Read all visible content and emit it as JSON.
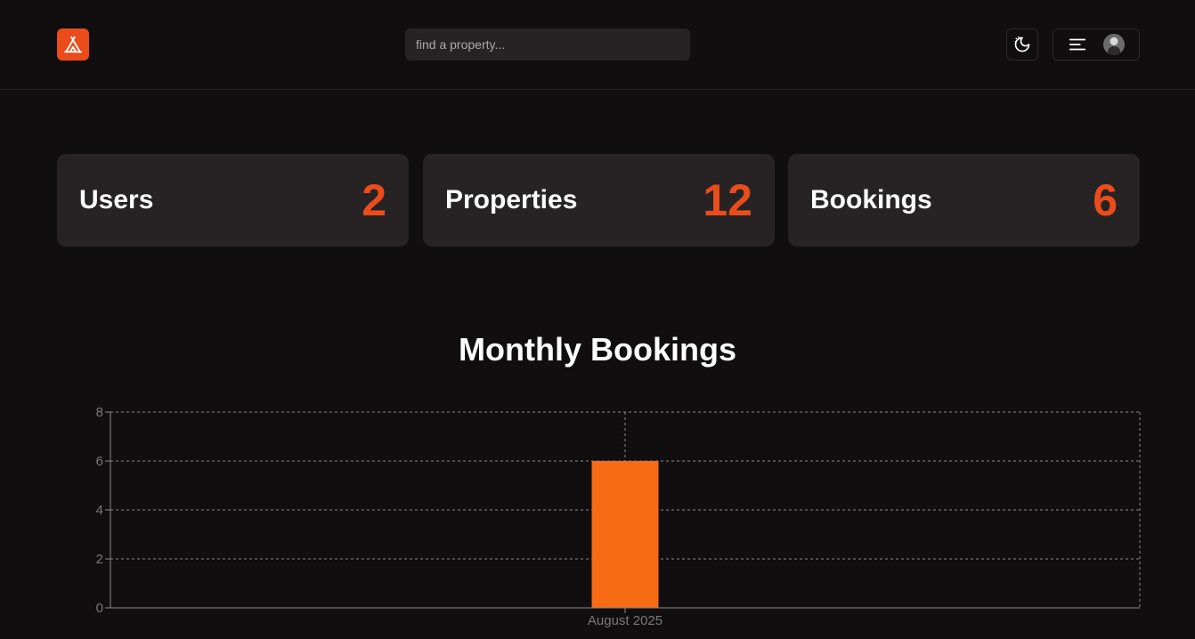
{
  "search": {
    "placeholder": "find a property..."
  },
  "icons": {
    "logo": "tent-icon",
    "theme": "moon-icon",
    "menu": "menu-icon",
    "user": "avatar"
  },
  "colors": {
    "accent": "#ea4c1c",
    "bar": "#f76b15",
    "background": "#100e0f",
    "card": "#272324"
  },
  "stats": [
    {
      "label": "Users",
      "value": "2"
    },
    {
      "label": "Properties",
      "value": "12"
    },
    {
      "label": "Bookings",
      "value": "6"
    }
  ],
  "chart_title": "Monthly Bookings",
  "chart_data": {
    "type": "bar",
    "categories": [
      "August 2025"
    ],
    "values": [
      6
    ],
    "title": "Monthly Bookings",
    "xlabel": "",
    "ylabel": "",
    "ylim": [
      0,
      8
    ],
    "yticks": [
      0,
      2,
      4,
      6,
      8
    ],
    "grid": true
  }
}
